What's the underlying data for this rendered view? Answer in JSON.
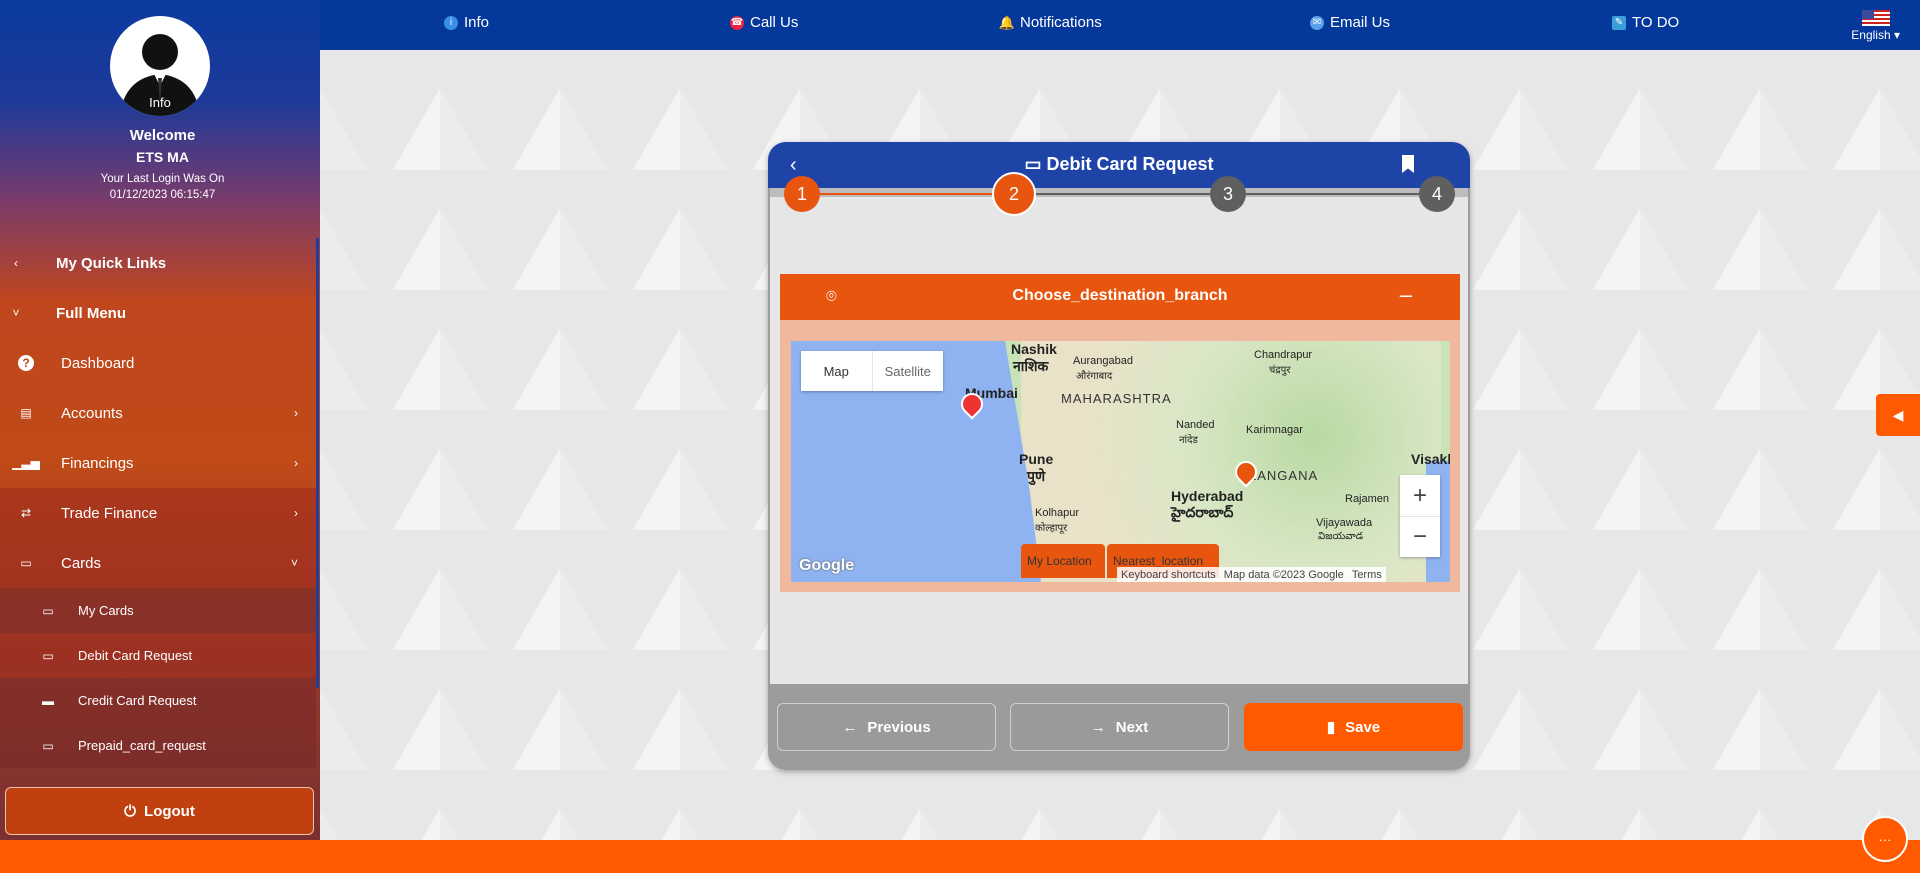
{
  "sidebar": {
    "avatar_label": "Info",
    "welcome": "Welcome",
    "user_name": "ETS MA",
    "last_login_label": "Your Last Login Was On",
    "last_login_value": "01/12/2023 06:15:47",
    "items": [
      {
        "label": "My Quick Links"
      },
      {
        "label": "Full Menu"
      },
      {
        "label": "Dashboard"
      },
      {
        "label": "Accounts"
      },
      {
        "label": "Financings"
      },
      {
        "label": "Trade Finance"
      },
      {
        "label": "Cards"
      },
      {
        "label": "My Cards"
      },
      {
        "label": "Debit Card Request"
      },
      {
        "label": "Credit Card Request"
      },
      {
        "label": "Prepaid_card_request"
      }
    ],
    "logout_label": "Logout"
  },
  "topbar": {
    "items": [
      {
        "label": "Info",
        "icon": "info-icon"
      },
      {
        "label": "Call Us",
        "icon": "agent-icon"
      },
      {
        "label": "Notifications",
        "icon": "bell-icon"
      },
      {
        "label": "Email Us",
        "icon": "mail-icon"
      },
      {
        "label": "TO DO",
        "icon": "todo-icon"
      }
    ],
    "language": "English"
  },
  "card": {
    "title": "Debit Card Request",
    "steps": [
      "1",
      "2",
      "3",
      "4"
    ],
    "current_step": 2,
    "panel_title": "Choose_destination_branch",
    "map": {
      "type_map": "Map",
      "type_satellite": "Satellite",
      "labels": {
        "nashik": "Nashik",
        "nashik_hi": "नाशिक",
        "aurangabad": "Aurangabad",
        "aurangabad_hi": "औरंगाबाद",
        "chandrapur": "Chandrapur",
        "chandrapur_hi": "चंद्रपुर",
        "mumbai": "Mumbai",
        "maharashtra": "MAHARASHTRA",
        "nanded": "Nanded",
        "nanded_hi": "नांदेड",
        "karimnagar": "Karimnagar",
        "pune": "Pune",
        "pune_hi": "पुणे",
        "telangana": "LANGANA",
        "visakh": "Visakl",
        "hyderabad": "Hyderabad",
        "hyderabad_te": "హైదరాబాద్",
        "rajahmundry": "Rajamen",
        "kolhapur": "Kolhapur",
        "kolhapur_hi": "कोल्हापूर",
        "vijayawada": "Vijayawada",
        "vijayawada_te": "విజయవాడ"
      },
      "my_location": "My Location",
      "nearest_location": "Nearest_location",
      "attribution": [
        "Keyboard shortcuts",
        "Map data ©2023 Google",
        "Terms"
      ],
      "google": "Google"
    },
    "previous_label": "Previous",
    "next_label": "Next",
    "save_label": "Save"
  },
  "colors": {
    "primary_blue": "#04389b",
    "accent_orange": "#ff5a00",
    "step_active": "#e8550f",
    "step_inactive": "#5f5f5f"
  }
}
